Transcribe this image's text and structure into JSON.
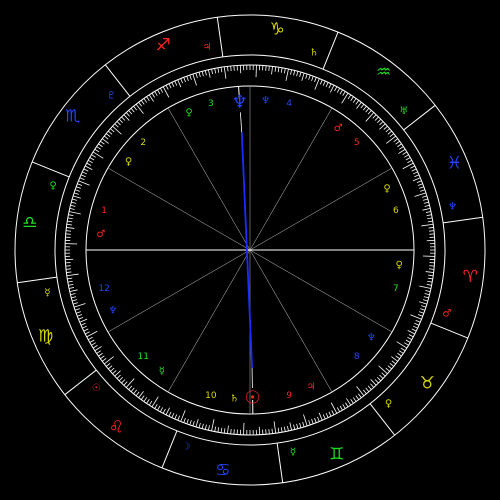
{
  "background": "#000000",
  "colors": {
    "ring": "#ffffff",
    "cusp": "#9a9a9a",
    "aspect": "#1a2cff",
    "fire": "#ff2222",
    "earth": "#d8d800",
    "air": "#22dd22",
    "water": "#2244ff"
  },
  "asc_longitude": 188,
  "signs": [
    {
      "name": "Aries",
      "glyph": "♈",
      "element": "fire"
    },
    {
      "name": "Taurus",
      "glyph": "♉",
      "element": "earth"
    },
    {
      "name": "Gemini",
      "glyph": "♊",
      "element": "air"
    },
    {
      "name": "Cancer",
      "glyph": "♋",
      "element": "water"
    },
    {
      "name": "Leo",
      "glyph": "♌",
      "element": "fire"
    },
    {
      "name": "Virgo",
      "glyph": "♍",
      "element": "earth"
    },
    {
      "name": "Libra",
      "glyph": "♎",
      "element": "air"
    },
    {
      "name": "Scorpio",
      "glyph": "♏",
      "element": "water"
    },
    {
      "name": "Sagittarius",
      "glyph": "♐",
      "element": "fire"
    },
    {
      "name": "Capricorn",
      "glyph": "♑",
      "element": "earth"
    },
    {
      "name": "Aquarius",
      "glyph": "♒",
      "element": "air"
    },
    {
      "name": "Pisces",
      "glyph": "♓",
      "element": "water"
    }
  ],
  "sign_ruler_markers": [
    {
      "sign": "Aries",
      "glyph": "♂",
      "element": "fire"
    },
    {
      "sign": "Taurus",
      "glyph": "♀",
      "element": "earth"
    },
    {
      "sign": "Gemini",
      "glyph": "☿",
      "element": "air"
    },
    {
      "sign": "Cancer",
      "glyph": "☽",
      "element": "water"
    },
    {
      "sign": "Leo",
      "glyph": "☉",
      "element": "fire"
    },
    {
      "sign": "Virgo",
      "glyph": "☿",
      "element": "earth"
    },
    {
      "sign": "Libra",
      "glyph": "♀",
      "element": "air"
    },
    {
      "sign": "Scorpio",
      "glyph": "♇",
      "element": "water"
    },
    {
      "sign": "Sagittarius",
      "glyph": "♃",
      "element": "fire"
    },
    {
      "sign": "Capricorn",
      "glyph": "♄",
      "element": "earth"
    },
    {
      "sign": "Aquarius",
      "glyph": "♅",
      "element": "air"
    },
    {
      "sign": "Pisces",
      "glyph": "♆",
      "element": "water"
    }
  ],
  "houses": [
    {
      "num": "1",
      "cusp": 188,
      "color": "fire"
    },
    {
      "num": "2",
      "cusp": 218,
      "color": "earth"
    },
    {
      "num": "3",
      "cusp": 248,
      "color": "air"
    },
    {
      "num": "4",
      "cusp": 278,
      "color": "water"
    },
    {
      "num": "5",
      "cusp": 308,
      "color": "fire"
    },
    {
      "num": "6",
      "cusp": 338,
      "color": "earth"
    },
    {
      "num": "7",
      "cusp": 8,
      "color": "air"
    },
    {
      "num": "8",
      "cusp": 38,
      "color": "water"
    },
    {
      "num": "9",
      "cusp": 68,
      "color": "fire"
    },
    {
      "num": "10",
      "cusp": 98,
      "color": "earth"
    },
    {
      "num": "11",
      "cusp": 128,
      "color": "air"
    },
    {
      "num": "12",
      "cusp": 158,
      "color": "water"
    }
  ],
  "house_rulers": [
    {
      "house": "1",
      "glyph": "♂",
      "color": "fire"
    },
    {
      "house": "2",
      "glyph": "♀",
      "color": "earth"
    },
    {
      "house": "3",
      "glyph": "♀",
      "color": "air"
    },
    {
      "house": "4",
      "glyph": "♆",
      "color": "water"
    },
    {
      "house": "5",
      "glyph": "♂",
      "color": "fire"
    },
    {
      "house": "6",
      "glyph": "♀",
      "color": "earth"
    },
    {
      "house": "7",
      "glyph": "♀",
      "color": "earth"
    },
    {
      "house": "8",
      "glyph": "♆",
      "color": "water"
    },
    {
      "house": "9",
      "glyph": "♃",
      "color": "fire"
    },
    {
      "house": "10",
      "glyph": "♄",
      "color": "earth"
    },
    {
      "house": "11",
      "glyph": "☿",
      "color": "air"
    },
    {
      "house": "12",
      "glyph": "♆",
      "color": "water"
    }
  ],
  "planets": [
    {
      "name": "Sun",
      "glyph": "☉",
      "longitude": 97,
      "color": "fire"
    },
    {
      "name": "Neptune",
      "glyph": "♆",
      "longitude": 274,
      "color": "water"
    }
  ],
  "aspects": [
    {
      "from": "Sun",
      "to": "Neptune",
      "type": "opposition",
      "color": "aspect"
    }
  ]
}
